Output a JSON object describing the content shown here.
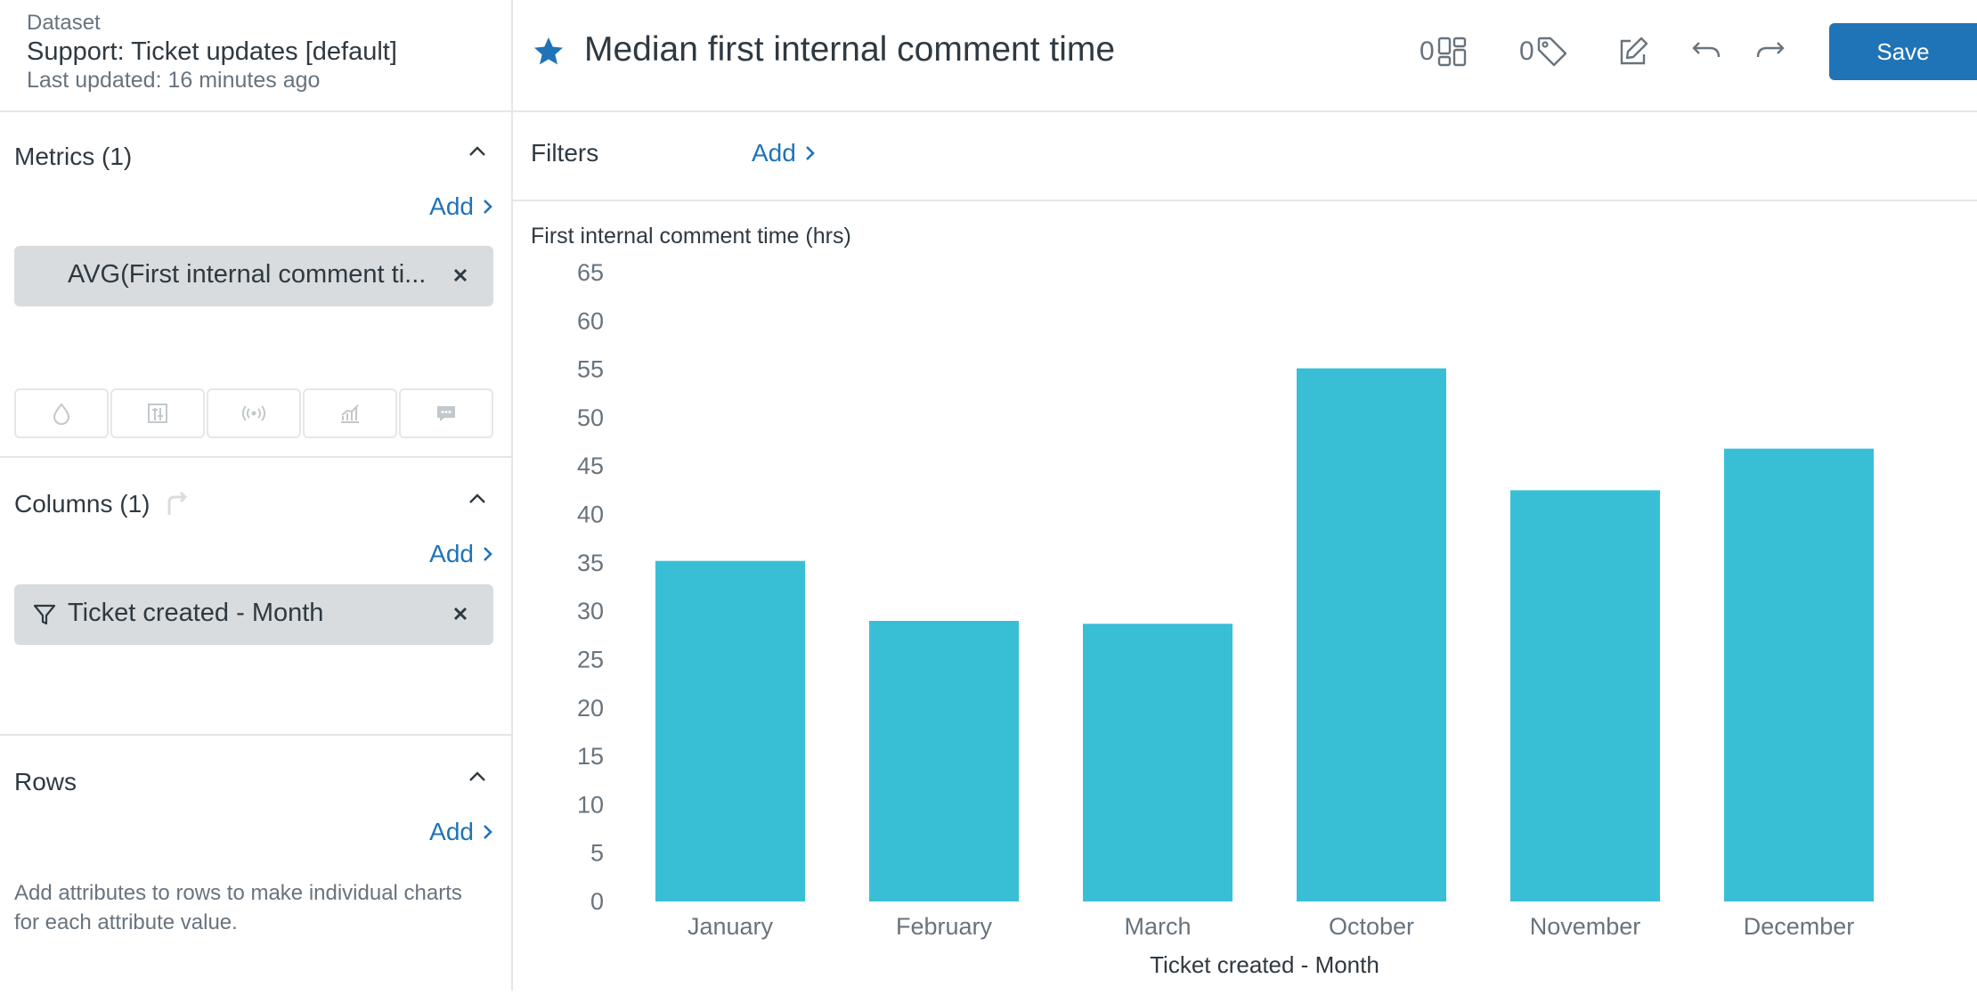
{
  "dataset": {
    "caption": "Dataset",
    "name": "Support: Ticket updates [default]",
    "updated": "Last updated: 16 minutes ago"
  },
  "metrics": {
    "title": "Metrics (1)",
    "add_label": "Add",
    "items": [
      {
        "label": "AVG(First internal comment ti..."
      }
    ]
  },
  "viz_tabs": [
    {
      "icon": "drop-icon"
    },
    {
      "icon": "sliders-icon"
    },
    {
      "icon": "broadcast-icon"
    },
    {
      "icon": "trend-chart-icon"
    },
    {
      "icon": "comment-icon"
    }
  ],
  "columns": {
    "title": "Columns (1)",
    "add_label": "Add",
    "items": [
      {
        "label": "Ticket created - Month"
      }
    ]
  },
  "rows": {
    "title": "Rows",
    "add_label": "Add",
    "help": "Add attributes to rows to make individual charts for each attribute value."
  },
  "header": {
    "title": "Median first internal comment time",
    "dashboards_count": "0",
    "tags_count": "0",
    "save_label": "Save"
  },
  "filters": {
    "label": "Filters",
    "add_label": "Add"
  },
  "colors": {
    "bar": "#38bfd6",
    "accent": "#1f73b7"
  },
  "chart_data": {
    "type": "bar",
    "categories": [
      "January",
      "February",
      "March",
      "October",
      "November",
      "December"
    ],
    "values": [
      35.2,
      29.0,
      28.7,
      55.1,
      42.5,
      46.8
    ],
    "ylabel": "First internal comment time (hrs)",
    "xlabel": "Ticket created - Month",
    "ylim": [
      0,
      65
    ],
    "yticks": [
      0,
      5,
      10,
      15,
      20,
      25,
      30,
      35,
      40,
      45,
      50,
      55,
      60,
      65
    ],
    "grid": false,
    "legend": "none"
  }
}
